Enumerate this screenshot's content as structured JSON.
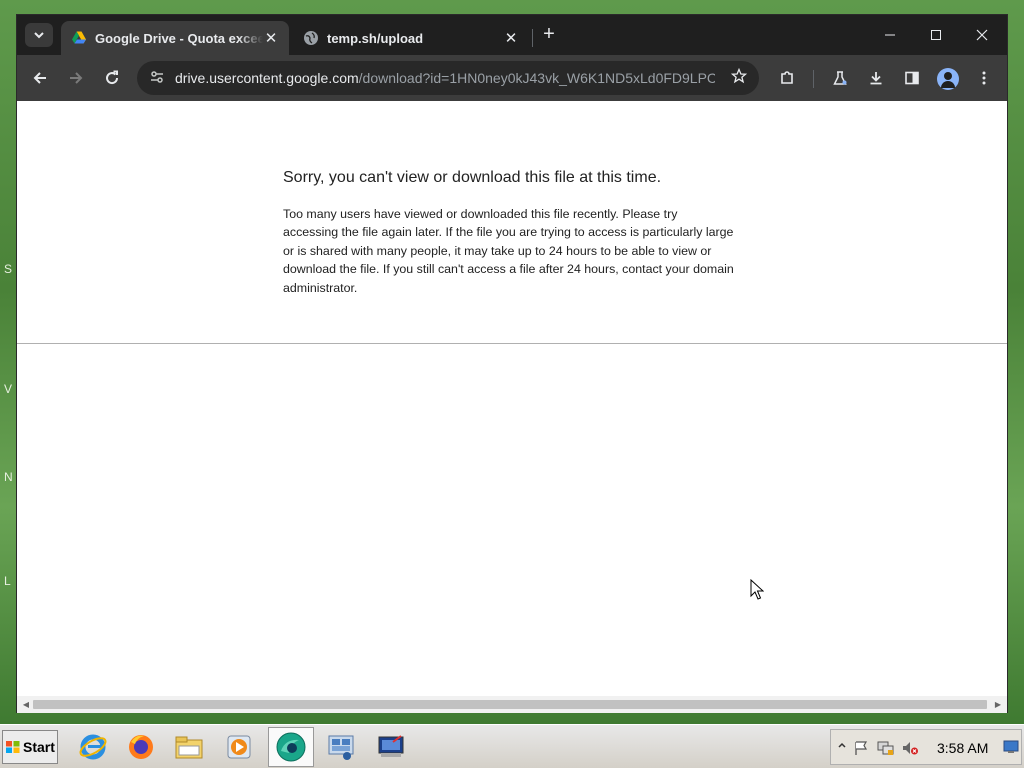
{
  "browser": {
    "tabs": [
      {
        "title": "Google Drive - Quota exceeded",
        "favicon": "google-drive-icon",
        "active": true
      },
      {
        "title": "temp.sh/upload",
        "favicon": "globe-icon",
        "active": false
      }
    ],
    "url_host": "drive.usercontent.google.com",
    "url_path": "/download?id=1HN0ney0kJ43vk_W6K1ND5xLd0FD9LPC...",
    "tab_close_glyph": "✕",
    "new_tab_glyph": "+"
  },
  "page": {
    "error_title": "Sorry, you can't view or download this file at this time.",
    "error_body": "Too many users have viewed or downloaded this file recently. Please try accessing the file again later. If the file you are trying to access is particularly large or is shared with many people, it may take up to 24 hours to be able to view or download the file. If you still can't access a file after 24 hours, contact your domain administrator."
  },
  "taskbar": {
    "start_label": "Start",
    "clock": "3:58 AM",
    "apps": [
      "internet-explorer-icon",
      "firefox-icon",
      "file-explorer-icon",
      "media-player-icon",
      "chrome-icon",
      "network-icon",
      "remote-desktop-icon"
    ]
  },
  "desktop": {
    "peek_letters": [
      "S",
      "V",
      "N",
      "L"
    ]
  },
  "colors": {
    "titlebar": "#1f1f1f",
    "toolbar": "#3c3c3c",
    "omnibox": "#282828",
    "avatar": "#8ab4f8"
  }
}
